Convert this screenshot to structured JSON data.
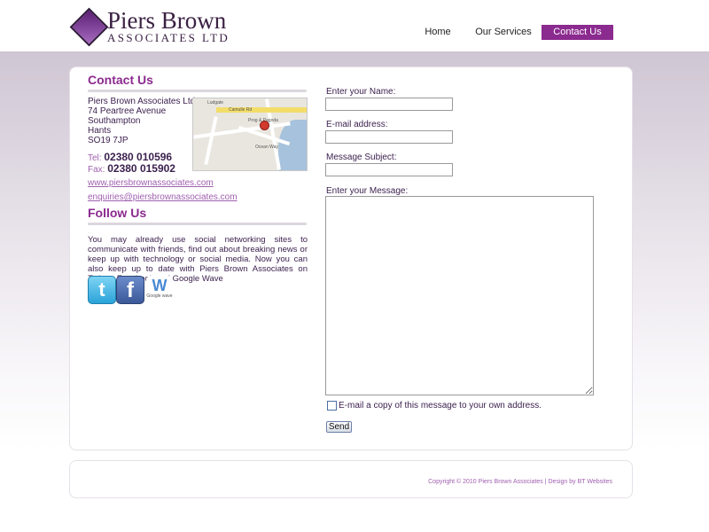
{
  "logo": {
    "name": "Piers Brown",
    "subtitle": "ASSOCIATES LTD"
  },
  "nav": {
    "home": "Home",
    "services": "Our Services",
    "contact": "Contact Us"
  },
  "contact": {
    "title": "Contact Us",
    "address_lines": [
      "Piers Brown Associates Ltd",
      "74 Peartree Avenue",
      "Southampton",
      "Hants",
      "SO19 7JP"
    ],
    "tel_label": "Tel:",
    "tel": "02380 010596",
    "fax_label": "Fax:",
    "fax": "02380 015902",
    "website": "www.piersbrownassociates.com",
    "email": "enquiries@piersbrownassociates.com",
    "map_labels": [
      "Camulle Rd",
      "Ocean Way",
      "Prog & Pagoda",
      "Ludgate"
    ]
  },
  "follow": {
    "title": "Follow Us",
    "text": "You may already use social networking sites to communicate with friends, find out about breaking news or keep up with technology or social media. Now you can also keep up to date with Piers Brown Associates on Twitter, Facebook and Google Wave",
    "twitter_glyph": "t",
    "facebook_glyph": "f",
    "wave_glyph": "W",
    "wave_text": "Google wave"
  },
  "form": {
    "name_label": "Enter your Name:",
    "email_label": "E-mail address:",
    "subject_label": "Message Subject:",
    "message_label": "Enter your Message:",
    "copy_label": "E-mail a copy of this message to your own address.",
    "send_label": "Send",
    "name_value": "",
    "email_value": "",
    "subject_value": "",
    "message_value": ""
  },
  "footer": {
    "copyright": "Copyright © 2010 Piers Brown Associates | Design by BT Websites"
  },
  "colors": {
    "accent": "#8b2a8f",
    "link": "#a060b0",
    "text": "#3a1f4d"
  }
}
